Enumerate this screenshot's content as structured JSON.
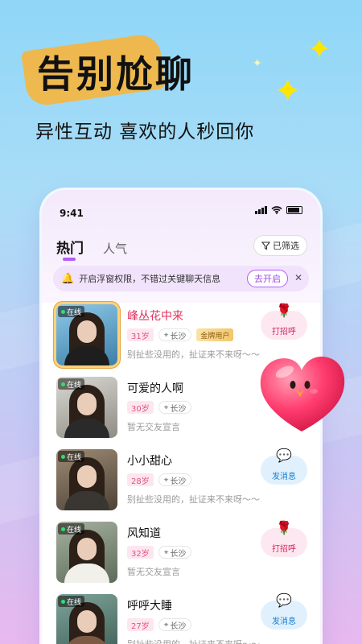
{
  "promo": {
    "headline": "告别尬聊",
    "subline": "异性互动 喜欢的人秒回你"
  },
  "status_bar": {
    "time": "9:41"
  },
  "tabs": {
    "hot": "热门",
    "popular": "人气"
  },
  "filter": {
    "label": "已筛选",
    "icon": "filter-icon"
  },
  "notice": {
    "text": "开启浮窗权限，不错过关键聊天信息",
    "button": "去开启",
    "close": "✕"
  },
  "users": [
    {
      "online": "在线",
      "name": "峰丛花中来",
      "age": "31岁",
      "city": "长沙",
      "badge": "金牌用户",
      "bio": "别扯些没用的，扯证来不来呀～～",
      "action": "打招呼",
      "action_type": "greet",
      "vip": true
    },
    {
      "online": "在线",
      "name": "可爱的人啊",
      "age": "30岁",
      "city": "长沙",
      "badge": "",
      "bio": "暂无交友宣言",
      "action": "",
      "action_type": "none",
      "vip": false
    },
    {
      "online": "在线",
      "name": "小小甜心",
      "age": "28岁",
      "city": "长沙",
      "badge": "",
      "bio": "别扯些没用的，扯证来不来呀～～",
      "action": "发消息",
      "action_type": "message",
      "vip": false
    },
    {
      "online": "在线",
      "name": "风知道",
      "age": "32岁",
      "city": "长沙",
      "badge": "",
      "bio": "暂无交友宣言",
      "action": "打招呼",
      "action_type": "greet",
      "vip": false
    },
    {
      "online": "在线",
      "name": "呼呼大睡",
      "age": "27岁",
      "city": "长沙",
      "badge": "",
      "bio": "别扯些没用的，扯证来不来呀～～",
      "action": "发消息",
      "action_type": "message",
      "vip": false
    }
  ],
  "colors": {
    "accent": "#b35df5",
    "vip_name": "#e0315e",
    "greet": "#d2285c",
    "message": "#1980d4"
  }
}
